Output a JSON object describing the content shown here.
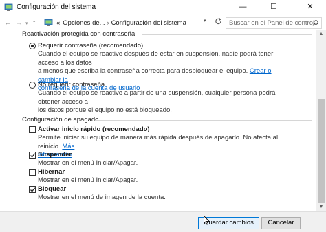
{
  "window": {
    "title": "Configuración del sistema",
    "controls": {
      "minimize": "—",
      "maximize": "☐",
      "close": "✕"
    }
  },
  "addressbar": {
    "back": "←",
    "forward": "→",
    "dropdown": "▾",
    "up": "↑",
    "breadcrumb": {
      "prefix": "«",
      "items": [
        "Opciones de...",
        "Configuración del sistema"
      ],
      "separator": "›"
    },
    "search_placeholder": "Buscar en el Panel de control"
  },
  "password_section": {
    "title": "Reactivación protegida con contraseña",
    "require": {
      "label": "Requerir contraseña (recomendado)",
      "selected": true,
      "desc_line1": "Cuando el equipo se reactive después de estar en suspensión, nadie podrá tener acceso a los datos",
      "desc_line2": "a menos que escriba la contraseña correcta para desbloquear el equipo.",
      "link_part1": "Crear o cambiar la",
      "link_part2": "contraseña de la cuenta de usuario"
    },
    "no_require": {
      "label": "No requerir contraseña",
      "selected": false,
      "desc_line1": "Cuando el equipo se reactive a partir de una suspensión, cualquier persona podrá obtener acceso a",
      "desc_line2": "los datos porque el equipo no está bloqueado."
    }
  },
  "shutdown_section": {
    "title": "Configuración de apagado",
    "fast_startup": {
      "label": "Activar inicio rápido (recomendado)",
      "checked": false,
      "desc": "Permite iniciar su equipo de manera más rápida después de apagarlo. No afecta al reinicio.",
      "link_part1": "Más",
      "link_part2": "información"
    },
    "sleep": {
      "label": "Suspender",
      "checked": true,
      "desc": "Mostrar en el menú Iniciar/Apagar."
    },
    "hibernate": {
      "label": "Hibernar",
      "checked": false,
      "desc": "Mostrar en el menú Iniciar/Apagar."
    },
    "lock": {
      "label": "Bloquear",
      "checked": true,
      "desc": "Mostrar en el menú de imagen de la cuenta."
    }
  },
  "footer": {
    "save_label": "Guardar cambios",
    "cancel_label": "Cancelar"
  },
  "scrollbar": {
    "up": "▲",
    "down": "▼"
  },
  "icons": {
    "app": "control-panel-icon",
    "search": "search-icon",
    "refresh": "refresh-icon"
  },
  "colors": {
    "link": "#0066cc",
    "accent": "#0078d7"
  }
}
